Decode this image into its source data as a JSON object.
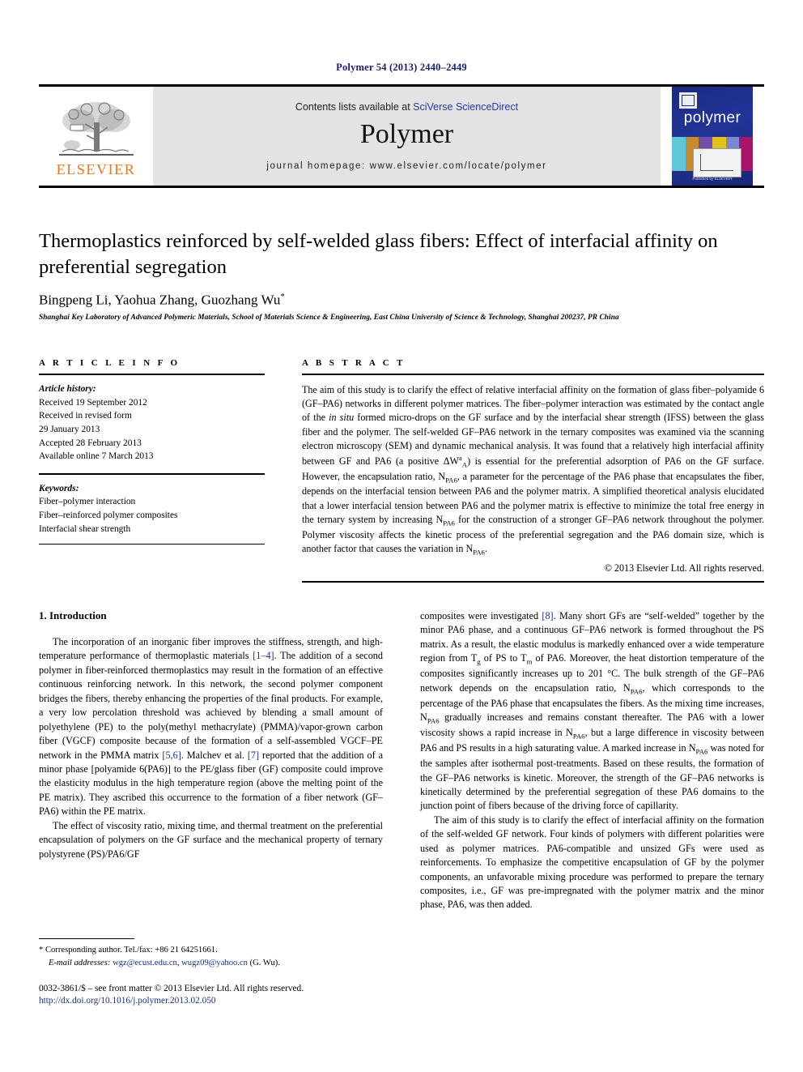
{
  "running_head": "Polymer 54 (2013) 2440–2449",
  "masthead": {
    "publisher_name": "ELSEVIER",
    "contents_prefix": "Contents lists available at ",
    "contents_link": "SciVerse ScienceDirect",
    "journal_name": "Polymer",
    "homepage": "journal homepage: www.elsevier.com/locate/polymer",
    "cover_title": "polymer",
    "cover_footer": "Published by ELSEVIER"
  },
  "article": {
    "title": "Thermoplastics reinforced by self-welded glass fibers: Effect of interfacial affinity on preferential segregation",
    "authors": "Bingpeng Li, Yaohua Zhang, Guozhang Wu",
    "author_marker": "*",
    "affiliation": "Shanghai Key Laboratory of Advanced Polymeric Materials, School of Materials Science & Engineering, East China University of Science & Technology, Shanghai 200237, PR China"
  },
  "article_info": {
    "heading": "A R T I C L E    I N F O",
    "history_label": "Article history:",
    "history": [
      "Received 19 September 2012",
      "Received in revised form",
      "29 January 2013",
      "Accepted 28 February 2013",
      "Available online 7 March 2013"
    ],
    "keywords_label": "Keywords:",
    "keywords": [
      "Fiber–polymer interaction",
      "Fiber–reinforced polymer composites",
      "Interfacial shear strength"
    ]
  },
  "abstract": {
    "heading": "A B S T R A C T",
    "part1": "The aim of this study is to clarify the effect of relative interfacial affinity on the formation of glass fiber–polyamide 6 (GF–PA6) networks in different polymer matrices. The fiber–polymer interaction was estimated by the contact angle of the ",
    "italic1": "in situ",
    "part2": " formed micro-drops on the GF surface and by the interfacial shear strength (IFSS) between the glass fiber and the polymer. The self-welded GF–PA6 network in the ternary composites was examined via the scanning electron microscopy (SEM) and dynamic mechanical analysis. It was found that a relatively high interfacial affinity between GF and PA6 (a positive ΔW",
    "part3": ") is essential for the preferential adsorption of PA6 on the GF surface. However, the encapsulation ratio, N",
    "part4": ", a parameter for the percentage of the PA6 phase that encapsulates the fiber, depends on the interfacial tension between PA6 and the polymer matrix. A simplified theoretical analysis elucidated that a lower interfacial tension between PA6 and the polymer matrix is effective to minimize the total free energy in the ternary system by increasing N",
    "part5": " for the construction of a stronger GF–PA6 network throughout the polymer. Polymer viscosity affects the kinetic process of the preferential segregation and the PA6 domain size, which is another factor that causes the variation in N",
    "part6": ".",
    "sub_pa6": "PA6",
    "sup_a": "a",
    "sub_a": "A",
    "copyright": "© 2013 Elsevier Ltd. All rights reserved."
  },
  "introduction": {
    "heading": "1.  Introduction",
    "left_p1_a": "The incorporation of an inorganic fiber improves the stiffness, strength, and high-temperature performance of thermoplastic materials ",
    "left_ref1": "[1–4]",
    "left_p1_b": ". The addition of a second polymer in fiber-reinforced thermoplastics may result in the formation of an effective continuous reinforcing network. In this network, the second polymer component bridges the fibers, thereby enhancing the properties of the final products. For example, a very low percolation threshold was achieved by blending a small amount of polyethylene (PE) to the poly(methyl methacrylate) (PMMA)/vapor-grown carbon fiber (VGCF) composite because of the formation of a self-assembled VGCF–PE network in the PMMA matrix ",
    "left_ref2": "[5,6]",
    "left_p1_c": ". Malchev et al. ",
    "left_ref3": "[7]",
    "left_p1_d": " reported that the addition of a minor phase [polyamide 6(PA6)] to the PE/glass fiber (GF) composite could improve the elasticity modulus in the high temperature region (above the melting point of the PE matrix). They ascribed this occurrence to the formation of a fiber network (GF–PA6) within the PE matrix.",
    "left_p2_a": "The effect of viscosity ratio, mixing time, and thermal treatment on the preferential encapsulation of polymers on the GF surface and the mechanical property of ternary polystyrene (PS)/PA6/GF",
    "right_p1_a": "composites were investigated ",
    "right_ref1": "[8]",
    "right_p1_b": ". Many short GFs are “self-welded” together by the minor PA6 phase, and a continuous GF–PA6 network is formed throughout the PS matrix. As a result, the elastic modulus is markedly enhanced over a wide temperature region from T",
    "right_p1_c": " of PS to T",
    "right_p1_d": " of PA6. Moreover, the heat distortion temperature of the composites significantly increases up to 201 °C. The bulk strength of the GF–PA6 network depends on the encapsulation ratio, N",
    "right_p1_e": ", which corresponds to the percentage of the PA6 phase that encapsulates the fibers. As the mixing time increases, N",
    "right_p1_f": " gradually increases and remains constant thereafter. The PA6 with a lower viscosity shows a rapid increase in N",
    "right_p1_g": ", but a large difference in viscosity between PA6 and PS results in a high saturating value. A marked increase in N",
    "right_p1_h": " was noted for the samples after isothermal post-treatments. Based on these results, the formation of the GF–PA6 networks is kinetic. Moreover, the strength of the GF–PA6 networks is kinetically determined by the preferential segregation of these PA6 domains to the junction point of fibers because of the driving force of capillarity.",
    "right_p2": "The aim of this study is to clarify the effect of interfacial affinity on the formation of the self-welded GF network. Four kinds of polymers with different polarities were used as polymer matrices. PA6-compatible and unsized GFs were used as reinforcements. To emphasize the competitive encapsulation of GF by the polymer components, an unfavorable mixing procedure was performed to prepare the ternary composites, i.e., GF was pre-impregnated with the polymer matrix and the minor phase, PA6, was then added.",
    "sub_g": "g",
    "sub_m": "m",
    "sub_pa6": "PA6"
  },
  "footnote": {
    "corresponding": "* Corresponding author. Tel./fax: +86 21 64251661.",
    "email_label": "E-mail addresses:",
    "email1": "wgz@ecust.edu.cn",
    "email_sep": ", ",
    "email2": "wugz09@yahoo.cn",
    "email_suffix": " (G. Wu)."
  },
  "page_footer": {
    "issn": "0032-3861/$ – see front matter © 2013 Elsevier Ltd. All rights reserved.",
    "doi": "http://dx.doi.org/10.1016/j.polymer.2013.02.050"
  }
}
